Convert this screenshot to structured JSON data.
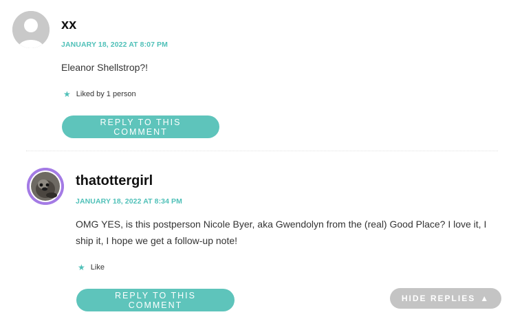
{
  "comments": [
    {
      "author": "xx",
      "date": "JANUARY 18, 2022 AT 8:07 PM",
      "text": "Eleanor Shellstrop?!",
      "likes_label": "Liked by 1 person",
      "reply_label": "REPLY TO THIS COMMENT",
      "avatar": "default-avatar-icon"
    },
    {
      "author": "thatottergirl",
      "date": "JANUARY 18, 2022 AT 8:34 PM",
      "text": "OMG YES, is this postperson Nicole Byer, aka Gwendolyn from the (real) Good Place? I love it, I ship it, I hope we get a follow-up note!",
      "likes_label": "Like",
      "reply_label": "REPLY TO THIS COMMENT",
      "avatar": "otter-avatar"
    }
  ],
  "hide_replies_label": "HIDE REPLIES",
  "icons": {
    "like": "star-icon",
    "hide": "triangle-up-icon"
  },
  "colors": {
    "accent": "#4fc0b8",
    "button": "#5ec4bb",
    "hide_button": "#c4c4c4",
    "avatar_ring": "#a47be5"
  }
}
